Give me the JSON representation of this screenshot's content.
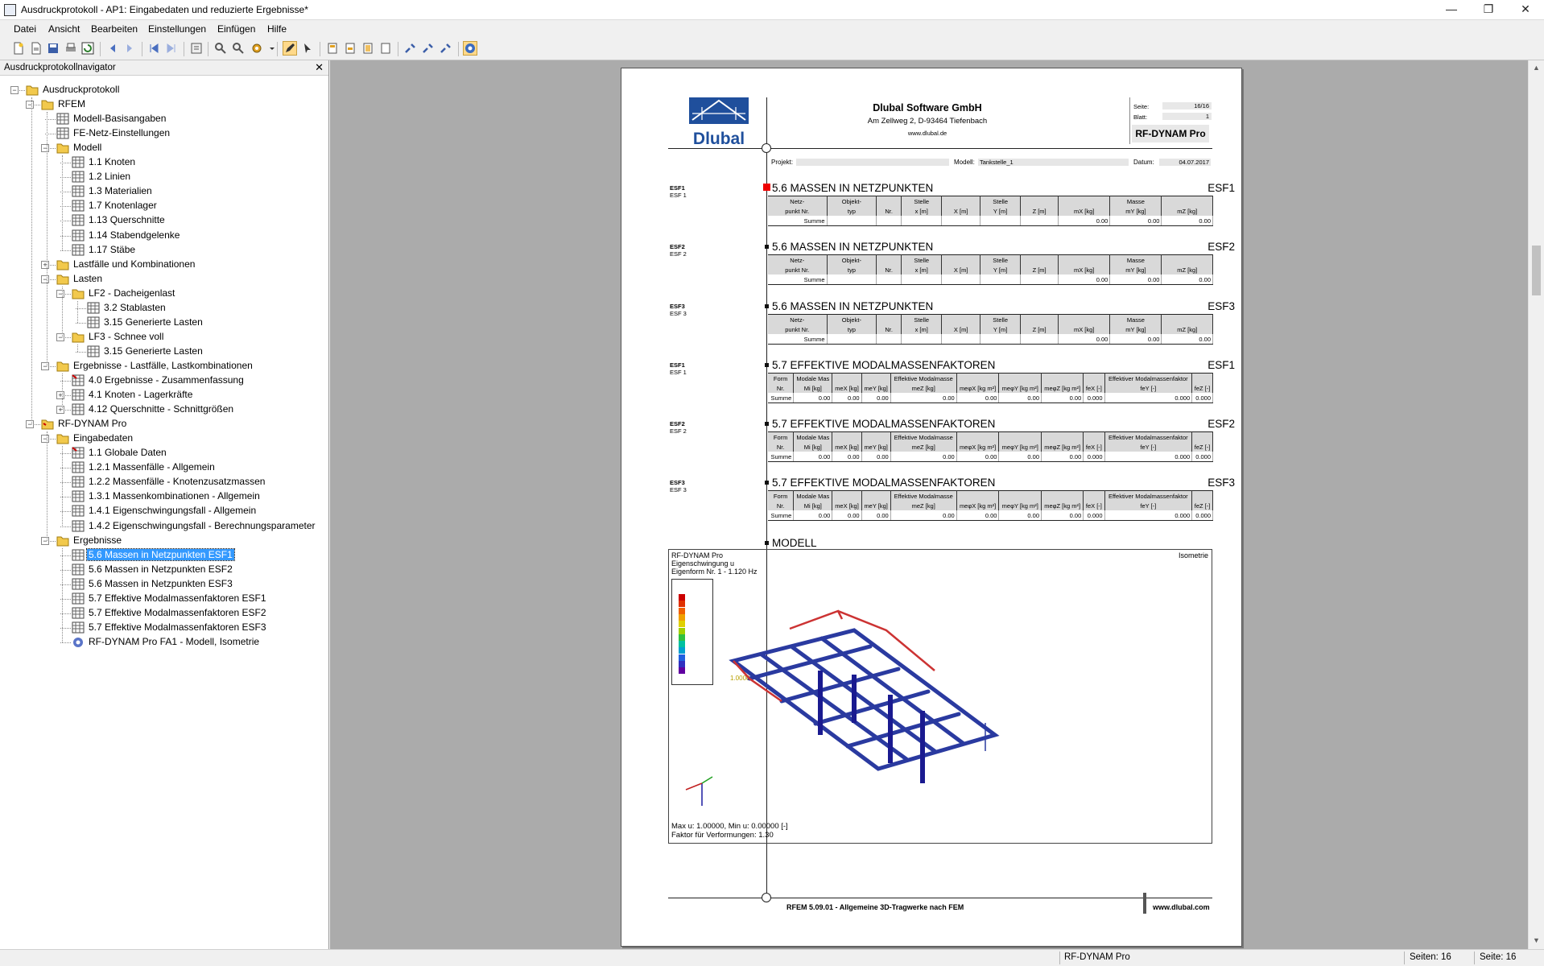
{
  "window": {
    "title": "Ausdruckprotokoll - AP1: Eingabedaten und reduzierte Ergebnisse*",
    "minimize": "—",
    "maximize": "❐",
    "close": "✕"
  },
  "menu": [
    "Datei",
    "Ansicht",
    "Bearbeiten",
    "Einstellungen",
    "Einfügen",
    "Hilfe"
  ],
  "navigator": {
    "title": "Ausdruckprotokollnavigator",
    "close": "✕",
    "items": [
      "Ausdruckprotokoll",
      "RFEM",
      "Modell-Basisangaben",
      "FE-Netz-Einstellungen",
      "Modell",
      "1.1 Knoten",
      "1.2 Linien",
      "1.3 Materialien",
      "1.7 Knotenlager",
      "1.13 Querschnitte",
      "1.14 Stabendgelenke",
      "1.17 Stäbe",
      "Lastfälle und Kombinationen",
      "Lasten",
      "LF2 - Dacheigenlast",
      "3.2 Stablasten",
      "3.15 Generierte Lasten",
      "LF3 - Schnee voll",
      "3.15 Generierte Lasten",
      "Ergebnisse - Lastfälle, Lastkombinationen",
      "4.0 Ergebnisse - Zusammenfassung",
      "4.1 Knoten - Lagerkräfte",
      "4.12 Querschnitte - Schnittgrößen",
      "RF-DYNAM Pro",
      "Eingabedaten",
      "1.1 Globale Daten",
      "1.2.1 Massenfälle - Allgemein",
      "1.2.2 Massenfälle - Knotenzusatzmassen",
      "1.3.1 Massenkombinationen - Allgemein",
      "1.4.1 Eigenschwingungsfall - Allgemein",
      "1.4.2 Eigenschwingungsfall - Berechnungsparameter",
      "Ergebnisse",
      "5.6 Massen in Netzpunkten ESF1",
      "5.6 Massen in Netzpunkten ESF2",
      "5.6 Massen in Netzpunkten ESF3",
      "5.7 Effektive Modalmassenfaktoren ESF1",
      "5.7 Effektive Modalmassenfaktoren ESF2",
      "5.7 Effektive Modalmassenfaktoren ESF3",
      "RF-DYNAM Pro FA1 - Modell, Isometrie"
    ],
    "selected": "5.6 Massen in Netzpunkten ESF1"
  },
  "page": {
    "logo": "Dlubal",
    "company": "Dlubal Software GmbH",
    "address": "Am Zellweg 2, D-93464 Tiefenbach",
    "web": "www.dlubal.de",
    "seite_label": "Seite:",
    "seite_value": "16/16",
    "blatt_label": "Blatt:",
    "blatt_value": "1",
    "product": "RF-DYNAM Pro",
    "projekt_label": "Projekt:",
    "projekt_value": "",
    "modell_label": "Modell:",
    "modell_value": "Tankstelle_1",
    "datum_label": "Datum:",
    "datum_value": "04.07.2017",
    "mass_sections": [
      {
        "title": "5.6 MASSEN IN NETZPUNKTEN",
        "tag": "ESF1",
        "side_a": "ESF1",
        "side_b": "ESF 1"
      },
      {
        "title": "5.6 MASSEN IN NETZPUNKTEN",
        "tag": "ESF2",
        "side_a": "ESF2",
        "side_b": "ESF 2"
      },
      {
        "title": "5.6 MASSEN IN NETZPUNKTEN",
        "tag": "ESF3",
        "side_a": "ESF3",
        "side_b": "ESF 3"
      }
    ],
    "mass_table": {
      "h1": [
        "Netz-",
        "Objekt-",
        "",
        "Stelle",
        "",
        "Stelle",
        "",
        "",
        "Masse",
        ""
      ],
      "h2": [
        "punkt Nr.",
        "typ",
        "Nr.",
        "x [m]",
        "X [m]",
        "Y [m]",
        "Z [m]",
        "mX [kg]",
        "mY [kg]",
        "mZ [kg]"
      ],
      "sum": [
        "Summe",
        "",
        "",
        "",
        "",
        "",
        "",
        "0.00",
        "0.00",
        "0.00"
      ]
    },
    "modal_sections": [
      {
        "title": "5.7 EFFEKTIVE MODALMASSENFAKTOREN",
        "tag": "ESF1",
        "side_a": "ESF1",
        "side_b": "ESF 1"
      },
      {
        "title": "5.7 EFFEKTIVE MODALMASSENFAKTOREN",
        "tag": "ESF2",
        "side_a": "ESF2",
        "side_b": "ESF 2"
      },
      {
        "title": "5.7 EFFEKTIVE MODALMASSENFAKTOREN",
        "tag": "ESF3",
        "side_a": "ESF3",
        "side_b": "ESF 3"
      }
    ],
    "modal_table": {
      "h1": [
        "Form",
        "Modale Mas",
        "",
        "",
        "Effektive Modalmasse",
        "",
        "",
        "",
        "",
        "Effektiver Modalmassenfaktor",
        ""
      ],
      "h2": [
        "Nr.",
        "Mi [kg]",
        "meX [kg]",
        "meY [kg]",
        "meZ [kg]",
        "meφX [kg m²]",
        "meφY [kg m²]",
        "meφZ [kg m²]",
        "feX [-]",
        "feY [-]",
        "feZ [-]"
      ],
      "sum": [
        "Summe",
        "0.00",
        "0.00",
        "0.00",
        "0.00",
        "0.00",
        "0.00",
        "0.00",
        "0.000",
        "0.000",
        "0.000"
      ]
    },
    "modell_title": "MODELL",
    "model": {
      "line1": "RF-DYNAM Pro",
      "line2": "Eigenschwingung u",
      "line3": "Eigenform Nr. 1 - 1.120 Hz",
      "view": "Isometrie",
      "legend_value": "1.00000",
      "max_min": "Max u: 1.00000, Min u: 0.00000 [-]",
      "factor": "Faktor für Verformungen: 1.30"
    },
    "footer_left": "RFEM 5.09.01 - Allgemeine 3D-Tragwerke nach FEM",
    "footer_right": "www.dlubal.com"
  },
  "status": {
    "program": "RF-DYNAM Pro",
    "pages": "Seiten: 16",
    "page": "Seite: 16"
  }
}
